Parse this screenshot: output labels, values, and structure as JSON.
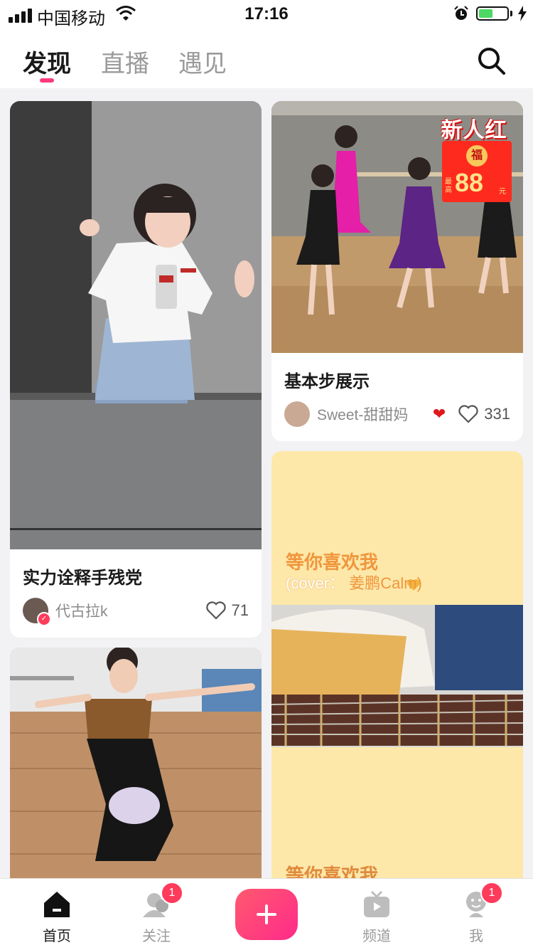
{
  "status_bar": {
    "carrier": "中国移动",
    "time": "17:16",
    "battery_level": 0.5
  },
  "header": {
    "tabs": [
      {
        "label": "发现",
        "active": true
      },
      {
        "label": "直播",
        "active": false
      },
      {
        "label": "遇见",
        "active": false
      }
    ],
    "search_icon": "search-icon"
  },
  "feed": {
    "card1": {
      "title": "实力诠释手残党",
      "author": "代古拉k",
      "likes": "71",
      "verified": true
    },
    "card2": {
      "title": "基本步展示",
      "author": "Sweet-甜甜妈",
      "likes": "331",
      "promo": {
        "title": "新人红包",
        "badge": "福",
        "prefix": "最高",
        "amount": "88",
        "unit": "元"
      }
    },
    "card3": {
      "overlay_line1": "等你喜欢我",
      "overlay_line2_a": "(cover：",
      "overlay_line2_b": "姜鹏Calm)",
      "caption": "等你喜欢我"
    }
  },
  "bottom_nav": [
    {
      "label": "首页",
      "icon": "home-icon",
      "active": true
    },
    {
      "label": "关注",
      "icon": "follow-icon",
      "badge": "1"
    },
    {
      "label": "add",
      "icon": "plus-icon"
    },
    {
      "label": "频道",
      "icon": "tv-icon"
    },
    {
      "label": "我",
      "icon": "profile-icon",
      "badge": "1"
    }
  ],
  "colors": {
    "accent": "#ff3b7c",
    "badge": "#ff3b5c",
    "card_bg": "#ffffff",
    "page_bg": "#f2f2f4"
  }
}
